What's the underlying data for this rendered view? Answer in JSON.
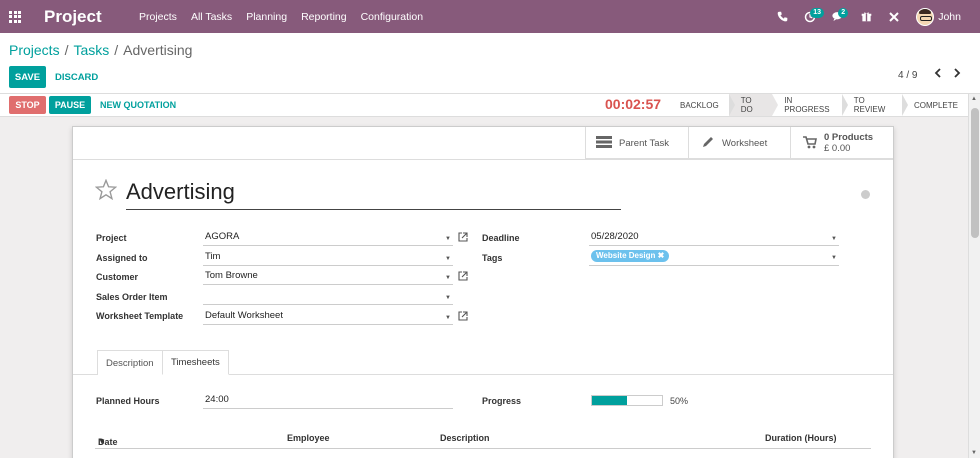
{
  "navbar": {
    "brand": "Project",
    "menu": [
      "Projects",
      "All Tasks",
      "Planning",
      "Reporting",
      "Configuration"
    ],
    "activity_badge": "13",
    "messages_badge": "2",
    "user_name": "John"
  },
  "breadcrumb": {
    "item1": "Projects",
    "item2": "Tasks",
    "current": "Advertising",
    "separator": "/"
  },
  "toolbar": {
    "save_label": "SAVE",
    "discard_label": "DISCARD",
    "pager": "4 / 9"
  },
  "statusbar": {
    "stop_label": "STOP",
    "pause_label": "PAUSE",
    "quotation_label": "NEW QUOTATION",
    "timer": "00:02:57",
    "stages": [
      "BACKLOG",
      "TO DO",
      "IN PROGRESS",
      "TO REVIEW",
      "COMPLETE"
    ],
    "active_stage": "TO DO"
  },
  "smart_buttons": {
    "parent_task": "Parent Task",
    "worksheet": "Worksheet",
    "products_count": "0 Products",
    "products_amount": "£ 0.00"
  },
  "task": {
    "title": "Advertising",
    "fields": {
      "project_label": "Project",
      "project_value": "AGORA",
      "assigned_label": "Assigned to",
      "assigned_value": "Tim",
      "customer_label": "Customer",
      "customer_value": "Tom Browne",
      "sale_line_label": "Sales Order Item",
      "sale_line_value": "",
      "worksheet_label": "Worksheet Template",
      "worksheet_value": "Default Worksheet",
      "deadline_label": "Deadline",
      "deadline_value": "05/28/2020",
      "tags_label": "Tags",
      "tag": "Website Design"
    }
  },
  "tabs": {
    "description": "Description",
    "timesheets": "Timesheets",
    "active": "Timesheets"
  },
  "timesheets": {
    "planned_label": "Planned Hours",
    "planned_value": "24:00",
    "progress_label": "Progress",
    "progress_percent": 50,
    "progress_text": "50%",
    "columns": [
      "Date",
      "Employee",
      "Description",
      "Duration (Hours)"
    ],
    "sort_indicator": "▼"
  },
  "colors": {
    "navbar": "#875a7b",
    "primary": "#00a09d",
    "stop": "#e06e6e",
    "timer": "#d9534f",
    "tag": "#6cc1ed"
  },
  "icons": [
    "apps-grid-icon",
    "phone-icon",
    "activity-clock-icon",
    "chat-icon",
    "gift-icon",
    "close-icon",
    "chevron-left-icon",
    "chevron-right-icon",
    "star-icon",
    "list-icon",
    "pencil-icon",
    "cart-icon",
    "external-link-icon",
    "caret-down-icon"
  ]
}
